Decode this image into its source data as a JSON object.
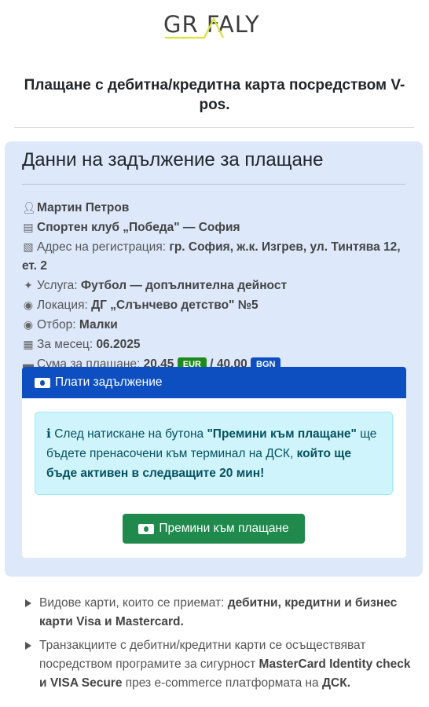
{
  "logo": {
    "text": "GR FALY"
  },
  "page_title": "Плащане с дебитна/кредитна карта посредством V-pos.",
  "panel": {
    "title": "Данни на задължение за плащане",
    "name": "Мартин Петров",
    "club": "Спортен клуб „Победа\" — София",
    "address_label": "Адрес на регистрация:",
    "address_value": "гр. София, ж.к. Изгрев, ул. Тинтява 12, ет. 2",
    "service_label": "Услуга:",
    "service_value": "Футбол — допълнителна дейност",
    "location_label": "Локация:",
    "location_value": "ДГ „Слънчево детство\" №5",
    "team_label": "Отбор:",
    "team_value": "Малки",
    "month_label": "За месец:",
    "month_value": "06.2025",
    "amount_label": "Сума за плащане:",
    "amount_eur": "20.45",
    "eur_badge": "EUR",
    "amount_sep": "/",
    "amount_bgn": "40.00",
    "bgn_badge": "BGN"
  },
  "pay": {
    "header": "Плати задължение",
    "alert_1": "След натискане на бутона ",
    "alert_2": "\"Премини към плащане\"",
    "alert_3": " ще бъдете пренасочени към терминал на ДСК, ",
    "alert_4": "който ще бъде активен в следващите 20 мин!",
    "button": "Премини към плащане"
  },
  "notes": {
    "n1_a": "Видове карти, които се приемат: ",
    "n1_b": "дебитни, кредитни и бизнес карти Visa и Mastercard.",
    "n2_a": "Транзакциите с дебитни/кредитни карти се осъществяват посредством програмите за сигурност ",
    "n2_b": "MasterCard Identity check и VISA Secure",
    "n2_c": " през e-commerce платформата на ",
    "n2_d": "ДСК."
  },
  "colors": {
    "panel_bg": "#dde8fb",
    "header_blue": "#0d4fc1",
    "button_green": "#1f8a4c",
    "alert_bg": "#cff4fc",
    "eur_green": "#1e8a1e",
    "logo_yellow": "#d8e23a"
  },
  "icons": [
    "user-icon",
    "building-icon",
    "map-icon",
    "handshake-icon",
    "location-pin-icon",
    "calendar-icon",
    "money-bill-icon",
    "info-icon"
  ]
}
